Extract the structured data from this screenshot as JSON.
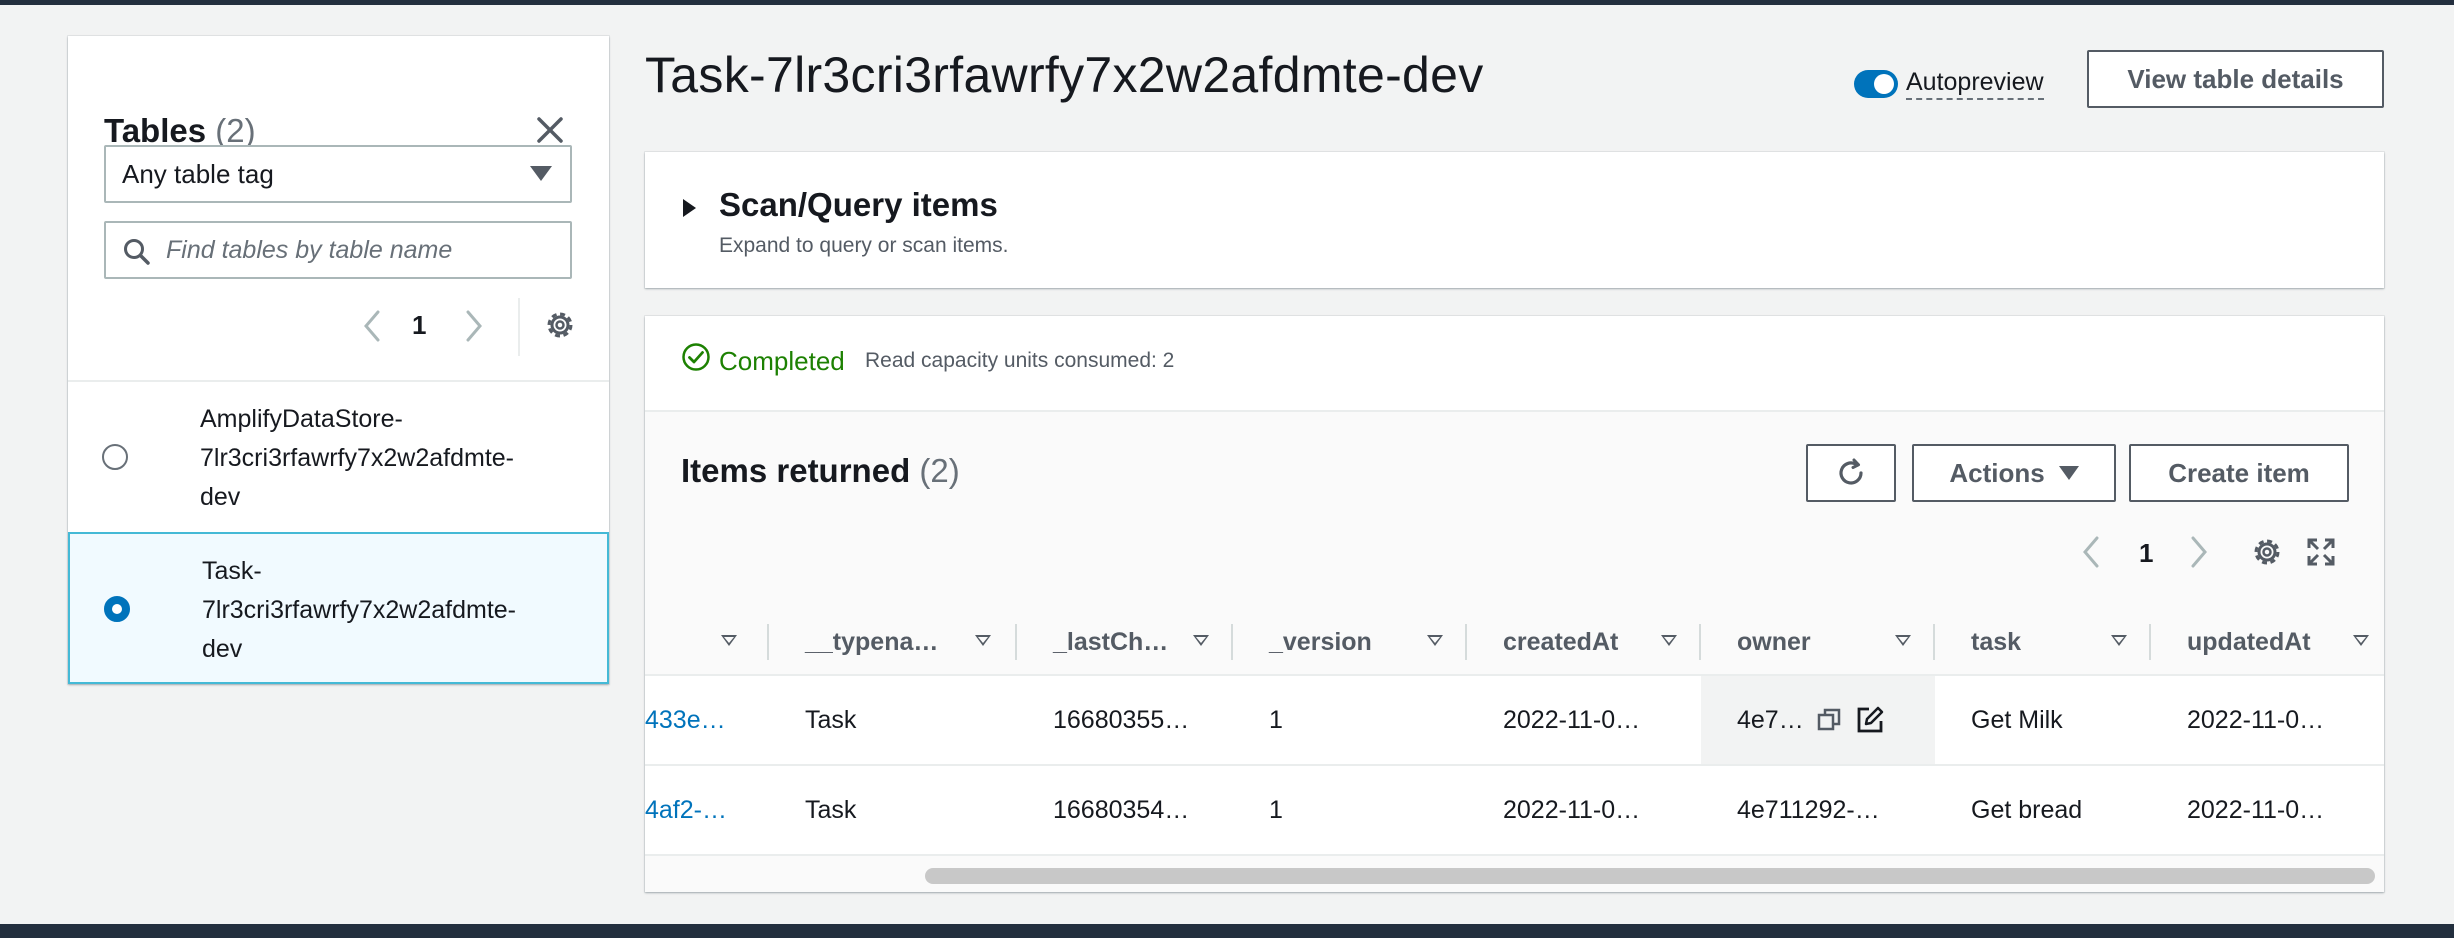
{
  "sidebar": {
    "title": "Tables",
    "count": "(2)",
    "tag_select": "Any table tag",
    "search_placeholder": "Find tables by table name",
    "page": "1",
    "tables": [
      {
        "name": "AmplifyDataStore-7lr3cri3rfawrfy7x2w2afdmte-dev",
        "line1": "AmplifyDataStore-",
        "line2": "7lr3cri3rfawrfy7x2w2afdmte-",
        "line3": "dev",
        "selected": false
      },
      {
        "name": "Task-7lr3cri3rfawrfy7x2w2afdmte-dev",
        "line1": "Task-",
        "line2": "7lr3cri3rfawrfy7x2w2afdmte-",
        "line3": "dev",
        "selected": true
      }
    ]
  },
  "header": {
    "title": "Task-7lr3cri3rfawrfy7x2w2afdmte-dev",
    "autopreview_label": "Autopreview",
    "view_details_label": "View table details"
  },
  "scan": {
    "title": "Scan/Query items",
    "subtitle": "Expand to query or scan items."
  },
  "status": {
    "text": "Completed",
    "rcu": "Read capacity units consumed: 2"
  },
  "items": {
    "title": "Items returned",
    "count": "(2)",
    "actions_label": "Actions",
    "create_label": "Create item",
    "page": "1",
    "columns": [
      "__typena…",
      "_lastCh…",
      "_version",
      "createdAt",
      "owner",
      "task",
      "updatedAt"
    ],
    "rows": [
      {
        "id": "433e…",
        "typename": "Task",
        "lastChanged": "16680355…",
        "version": "1",
        "createdAt": "2022-11-0…",
        "owner": "4e7…",
        "task": "Get Milk",
        "updatedAt": "2022-11-0…"
      },
      {
        "id": "4af2-…",
        "typename": "Task",
        "lastChanged": "16680354…",
        "version": "1",
        "createdAt": "2022-11-0…",
        "owner": "4e711292-…",
        "task": "Get bread",
        "updatedAt": "2022-11-0…"
      }
    ]
  },
  "colors": {
    "accent": "#0073bb",
    "success": "#1d8102",
    "nav_dark": "#232f3e"
  }
}
